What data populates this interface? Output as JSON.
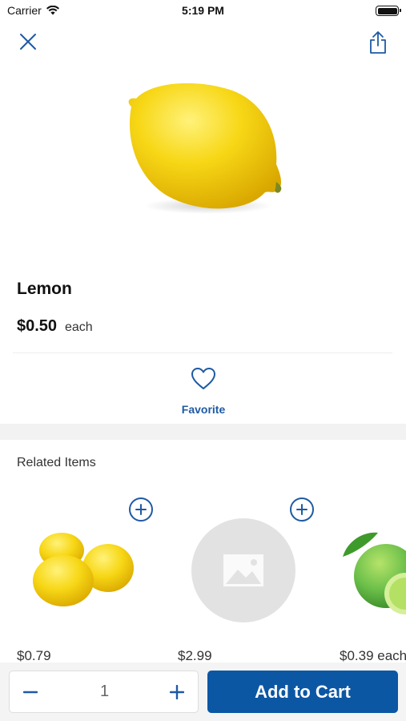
{
  "status_bar": {
    "carrier": "Carrier",
    "time": "5:19 PM",
    "icons": [
      "wifi-icon",
      "battery-icon"
    ]
  },
  "nav": {
    "close_icon": "close-icon",
    "share_icon": "share-icon"
  },
  "product": {
    "name": "Lemon",
    "price": "$0.50",
    "unit": "each",
    "image": "lemon-image"
  },
  "favorite": {
    "label": "Favorite",
    "icon": "heart-icon"
  },
  "related": {
    "title": "Related Items",
    "items": [
      {
        "price": "$0.79",
        "image": "lemons-image"
      },
      {
        "price": "$2.99",
        "image": "image-placeholder-icon"
      },
      {
        "price": "$0.39 each",
        "image": "limes-image"
      }
    ]
  },
  "cart": {
    "quantity": "1",
    "add_label": "Add to Cart"
  },
  "colors": {
    "accent": "#0b57a4",
    "link": "#1e5aa3",
    "lemon": "#f5d312",
    "lime": "#6cc04a"
  }
}
